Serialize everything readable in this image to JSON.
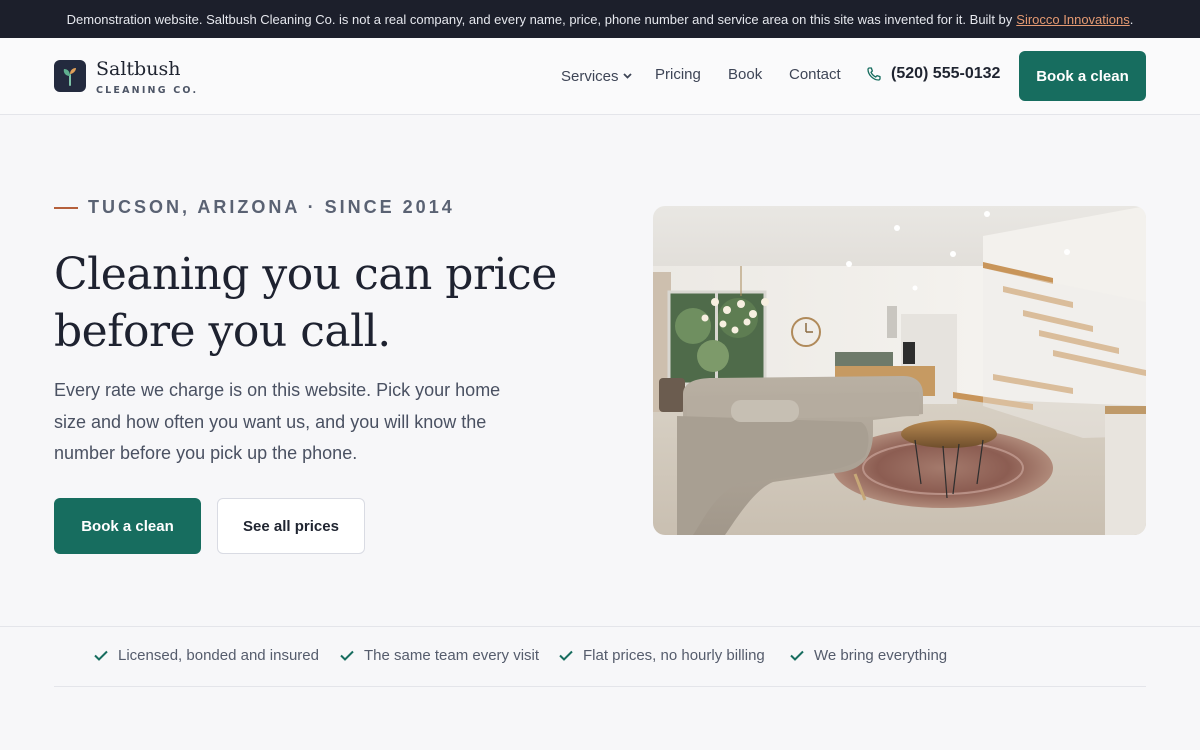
{
  "banner": {
    "text": "Demonstration website. Saltbush Cleaning Co. is not a real company, and every name, price, phone number and service area on this site was invented for it. Built by",
    "link_label": "Sirocco Innovations",
    "trailing": "."
  },
  "brand": {
    "name": "Saltbush",
    "subtitle": "CLEANING CO.",
    "icon": "sprout-icon"
  },
  "nav": {
    "items": [
      "Services",
      "Pricing",
      "Book",
      "Contact"
    ],
    "phone": "(520) 555-0132",
    "cta_label": "Book a clean"
  },
  "hero": {
    "eyebrow": "TUCSON, ARIZONA · SINCE 2014",
    "title_line1": "Cleaning you can price",
    "title_line2": "before you call.",
    "body": "Every rate we charge is on this website. Pick your home size and how often you want us, and you will know the number before you pick up the phone.",
    "primary_label": "Book a clean",
    "secondary_label": "See all prices"
  },
  "trust": [
    "Licensed, bonded and insured",
    "The same team every visit",
    "Flat prices, no hourly billing",
    "We bring everything"
  ],
  "colors": {
    "accent": "#176d5f",
    "dark": "#1c1f2b",
    "eyebrow_rule": "#b5603c",
    "link": "#e59a72"
  }
}
